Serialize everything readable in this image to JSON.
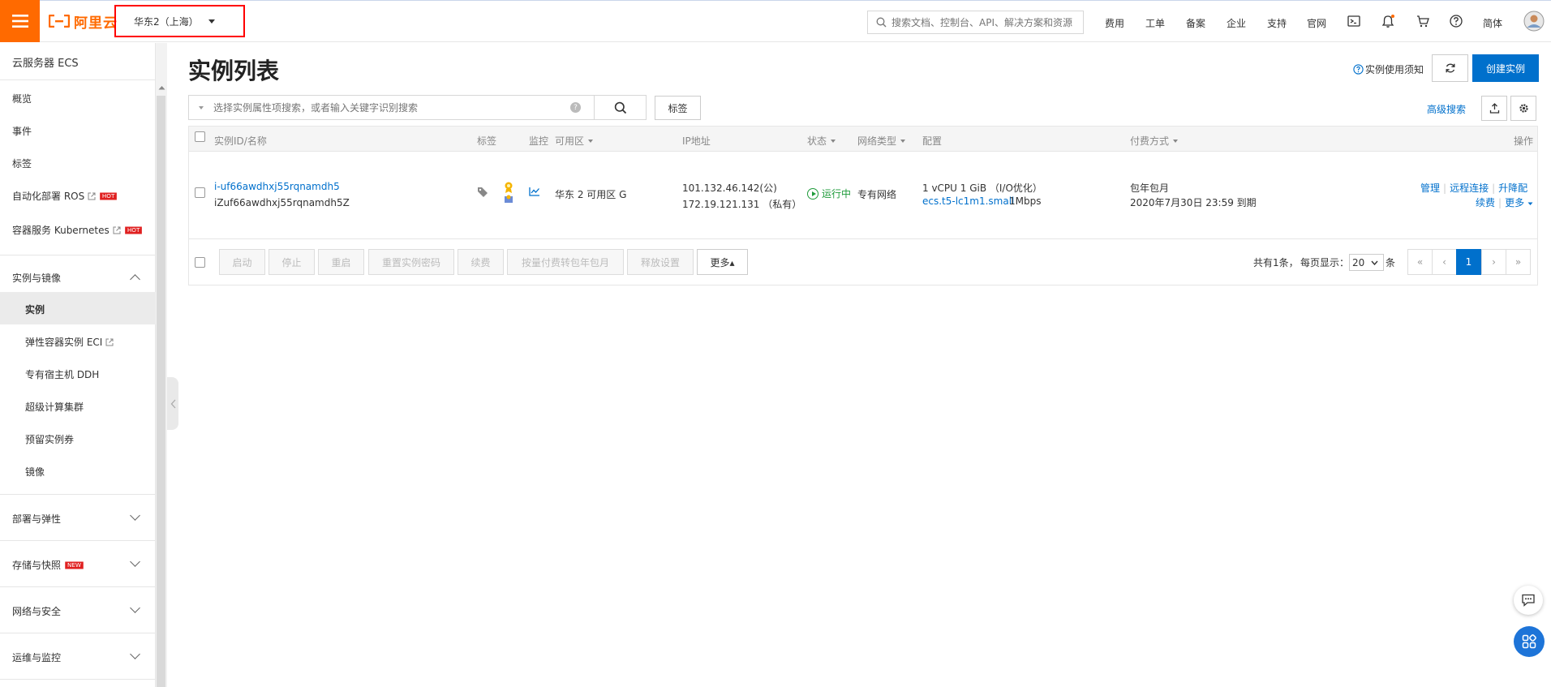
{
  "topbar": {
    "logo_text": "阿里云",
    "region": "华东2（上海）",
    "search_placeholder": "搜索文档、控制台、API、解决方案和资源",
    "nav": [
      "费用",
      "工单",
      "备案",
      "企业",
      "支持",
      "官网"
    ],
    "lang": "简体"
  },
  "sidebar": {
    "title": "云服务器 ECS",
    "items": {
      "overview": "概览",
      "events": "事件",
      "tags": "标签",
      "ros": "自动化部署 ROS",
      "k8s": "容器服务 Kubernetes",
      "group_instances": "实例与镜像",
      "instances": "实例",
      "eci": "弹性容器实例 ECI",
      "ddh": "专有宿主机 DDH",
      "supercompute": "超级计算集群",
      "reserved": "预留实例券",
      "images": "镜像",
      "group_deploy": "部署与弹性",
      "group_storage": "存储与快照",
      "group_network": "网络与安全",
      "group_ops": "运维与监控"
    },
    "badge_hot": "HOT",
    "badge_new": "NEW"
  },
  "main": {
    "title": "实例列表",
    "help_link": "实例使用须知",
    "create_button": "创建实例",
    "filter_placeholder": "选择实例属性项搜索，或者输入关键字识别搜索",
    "tag_button": "标签",
    "advanced_search": "高级搜索"
  },
  "table": {
    "headers": {
      "id_name": "实例ID/名称",
      "tag": "标签",
      "monitor": "监控",
      "zone": "可用区",
      "ip": "IP地址",
      "status": "状态",
      "network": "网络类型",
      "config": "配置",
      "billing": "付费方式",
      "actions": "操作"
    },
    "row": {
      "id": "i-uf66awdhxj55rqnamdh5",
      "name": "iZuf66awdhxj55rqnamdh5Z",
      "zone": "华东 2 可用区 G",
      "ip_public": "101.132.46.142(公)",
      "ip_private": "172.19.121.131 （私有）",
      "status": "运行中",
      "network": "专有网络",
      "config_line1": "1 vCPU 1 GiB （I/O优化）",
      "instance_type": "ecs.t5-lc1m1.small",
      "bandwidth": "1Mbps",
      "billing_type": "包年包月",
      "expire": "2020年7月30日 23:59 到期",
      "actions": {
        "manage": "管理",
        "remote": "远程连接",
        "upgrade": "升降配",
        "renew": "续费",
        "more": "更多"
      }
    }
  },
  "actions_bar": {
    "start": "启动",
    "stop": "停止",
    "restart": "重启",
    "reset_password": "重置实例密码",
    "renew": "续费",
    "convert": "按量付费转包年包月",
    "release": "释放设置",
    "more": "更多▴"
  },
  "pager": {
    "total_text": "共有1条，",
    "per_page_label": "每页显示：",
    "per_page": "20",
    "unit": "条",
    "first": "«",
    "prev": "‹",
    "current": "1",
    "next": "›",
    "last": "»"
  },
  "colors": {
    "brand": "#ff6a00",
    "primary": "#0070cc",
    "running": "#1e9b3a",
    "highlight_border": "#ff0000"
  }
}
